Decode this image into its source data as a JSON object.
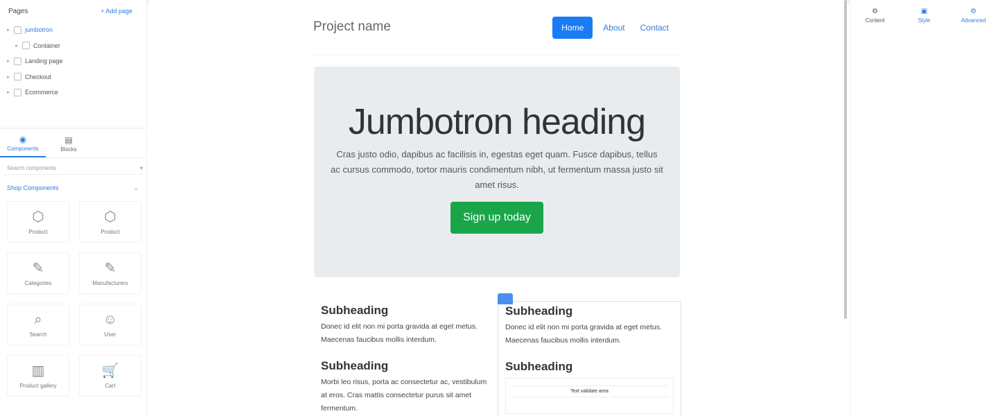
{
  "layers": {
    "title": "Pages",
    "add_label": "+ Add page",
    "items": [
      {
        "label": "jumbotron",
        "selected": true,
        "indent": false,
        "toggle": "▸"
      },
      {
        "label": "Container",
        "selected": false,
        "indent": true,
        "toggle": "▸"
      },
      {
        "label": "Landing page",
        "selected": false,
        "indent": false,
        "toggle": "▸"
      },
      {
        "label": "Checkout",
        "selected": false,
        "indent": false,
        "toggle": "▸"
      },
      {
        "label": "Ecommerce",
        "selected": false,
        "indent": false,
        "toggle": "▸"
      }
    ]
  },
  "left_tabs": [
    {
      "label": "Components",
      "icon": "◉",
      "icon_name": "components-icon",
      "active": true
    },
    {
      "label": "Blocks",
      "icon": "▤",
      "icon_name": "blocks-icon",
      "active": false
    }
  ],
  "search": {
    "placeholder": "Search components",
    "arrow": "▾"
  },
  "group": {
    "label": "Shop Components",
    "chevron": "⌄"
  },
  "components": [
    {
      "label": "Product",
      "icon": "⬡",
      "icon_name": "product-icon"
    },
    {
      "label": "Product",
      "icon": "⬡",
      "icon_name": "product-icon"
    },
    {
      "label": "Categories",
      "icon": "✎",
      "icon_name": "categories-icon"
    },
    {
      "label": "Manufacturers",
      "icon": "✎",
      "icon_name": "manufacturers-icon"
    },
    {
      "label": "Search",
      "icon": "⌕",
      "icon_name": "search-icon"
    },
    {
      "label": "User",
      "icon": "☺",
      "icon_name": "user-icon"
    },
    {
      "label": "Product gallery",
      "icon": "▥",
      "icon_name": "gallery-icon"
    },
    {
      "label": "Cart",
      "icon": "🛒",
      "icon_name": "cart-icon"
    }
  ],
  "site": {
    "brand": "Project name",
    "nav": [
      {
        "label": "Home",
        "active": true
      },
      {
        "label": "About",
        "active": false
      },
      {
        "label": "Contact",
        "active": false
      }
    ],
    "jumbotron": {
      "heading": "Jumbotron heading",
      "text": "Cras justo odio, dapibus ac facilisis in, egestas eget quam. Fusce dapibus, tellus ac cursus commodo, tortor mauris condimentum nibh, ut fermentum massa justo sit amet risus.",
      "button": "Sign up today"
    },
    "col1": [
      {
        "heading": "Subheading",
        "text": "Donec id elit non mi porta gravida at eget metus. Maecenas faucibus mollis interdum."
      },
      {
        "heading": "Subheading",
        "text": "Morbi leo risus, porta ac consectetur ac, vestibulum at eros. Cras mattis consectetur purus sit amet fermentum."
      }
    ],
    "col2": [
      {
        "heading": "Subheading",
        "text": "Donec id elit non mi porta gravida at eget metus. Maecenas faucibus mollis interdum."
      },
      {
        "heading": "Subheading",
        "form_button": "Text validate area"
      }
    ]
  },
  "right_tabs": [
    {
      "label": "Content",
      "icon": "⚙",
      "icon_name": "content-icon"
    },
    {
      "label": "Style",
      "icon": "▣",
      "icon_name": "style-icon"
    },
    {
      "label": "Advanced",
      "icon": "⚙",
      "icon_name": "advanced-icon"
    }
  ],
  "colors": {
    "accent": "#1a7cf5",
    "success": "#1aa54a",
    "jumbotron_bg": "#e9ecef"
  }
}
